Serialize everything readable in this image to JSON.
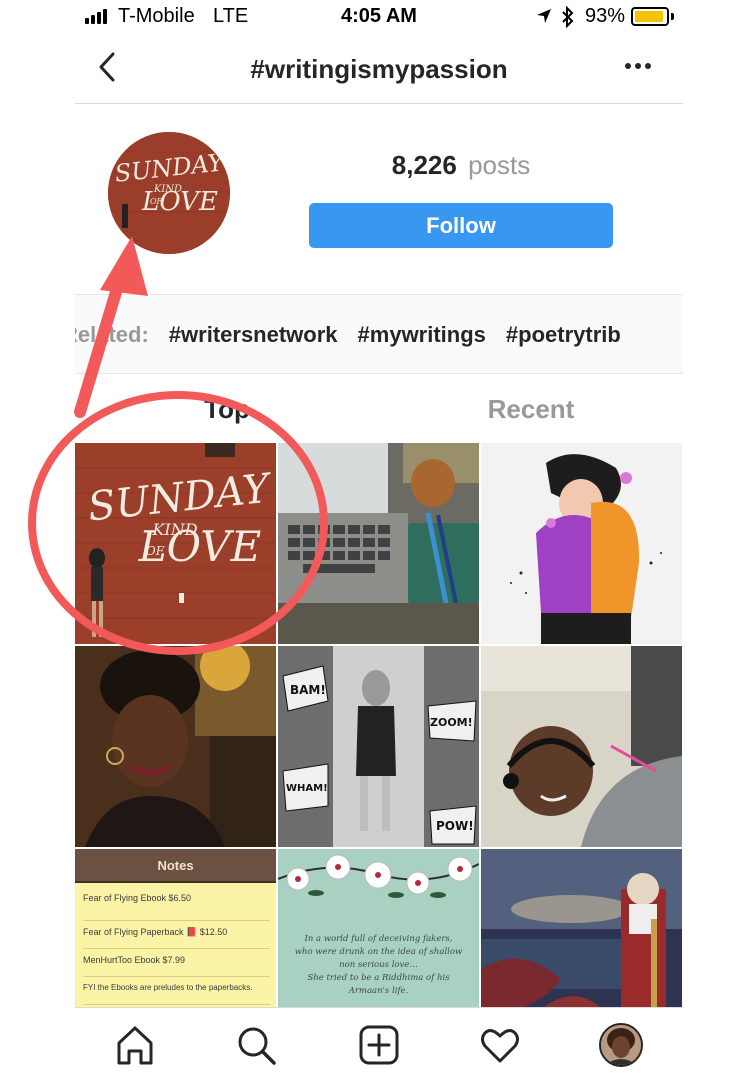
{
  "status_bar": {
    "carrier": "T-Mobile",
    "network": "LTE",
    "time": "4:05 AM",
    "battery_percent": "93%",
    "battery_level": 0.93,
    "battery_color": "#f5c400"
  },
  "nav": {
    "title": "#writingismypassion",
    "back_icon": "chevron-left-icon",
    "more_icon": "more-horizontal-icon"
  },
  "header": {
    "post_count": "8,226",
    "post_label": "posts",
    "follow_label": "Follow",
    "follow_color": "#3897f0",
    "avatar_text": [
      "SUNDAY",
      "KIND",
      "OF",
      "LOVE"
    ]
  },
  "related": {
    "label": "Related:",
    "tags": [
      "#writersnetwork",
      "#mywritings",
      "#poetrytrib"
    ]
  },
  "tabs": {
    "top": "Top",
    "recent": "Recent"
  },
  "grid": {
    "mural_text": [
      "SUNDAY",
      "KIND",
      "OF",
      "LOVE"
    ],
    "comic_words": [
      "BAM!",
      "ZOOM!",
      "WHAM!",
      "POW!"
    ],
    "notes": {
      "title": "Notes",
      "lines": [
        "Fear of Flying Ebook $6.50",
        "Fear of Flying Paperback 📕 $12.50",
        "MenHurtToo Ebook $7.99",
        "FYI the Ebooks are preludes to the paperbacks."
      ]
    },
    "quote": [
      "In a world full of deceiving fakers,",
      "who were drunk on the idea of shallow",
      "non serious love…",
      "She tried to be a Riddhima of his",
      "Armaan's life."
    ]
  },
  "tab_bar": {
    "icons": [
      "home-icon",
      "search-icon",
      "add-post-icon",
      "activity-heart-icon",
      "profile-avatar-icon"
    ]
  },
  "annotation": {
    "color": "#f25a5a"
  }
}
